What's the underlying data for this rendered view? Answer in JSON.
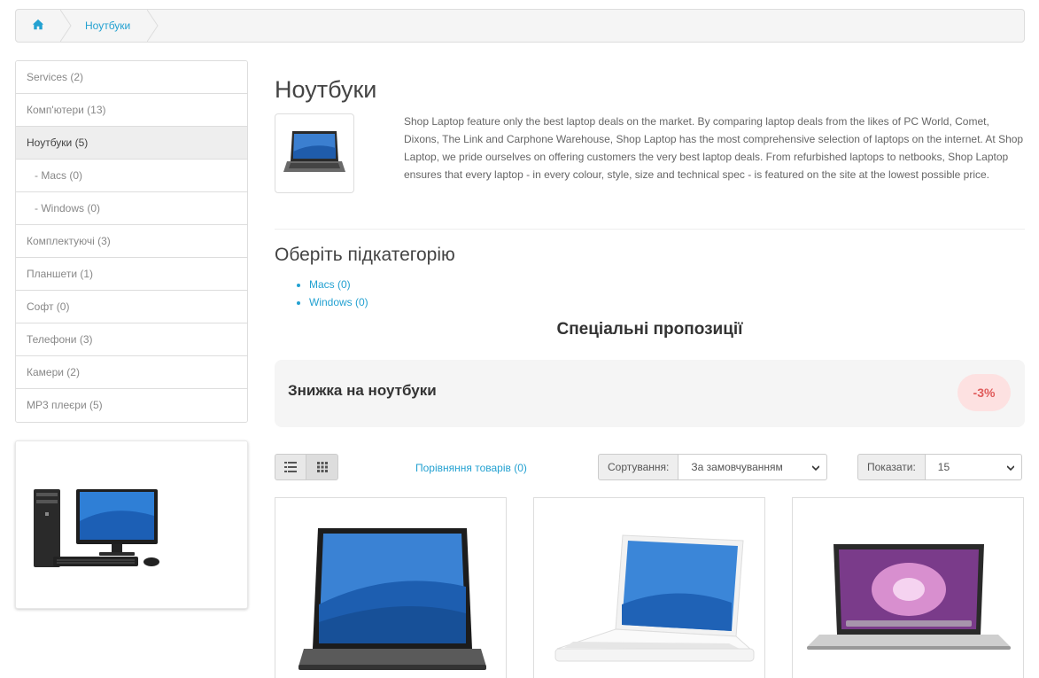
{
  "breadcrumb": {
    "home_icon": "home-icon",
    "current": "Ноутбуки"
  },
  "sidebar": {
    "items": [
      {
        "label": "Services (2)"
      },
      {
        "label": "Комп'ютери (13)"
      },
      {
        "label": "Ноутбуки (5)"
      },
      {
        "label": "- Macs (0)"
      },
      {
        "label": "- Windows (0)"
      },
      {
        "label": "Комплектуючі (3)"
      },
      {
        "label": "Планшети (1)"
      },
      {
        "label": "Софт (0)"
      },
      {
        "label": "Телефони (3)"
      },
      {
        "label": "Камери (2)"
      },
      {
        "label": "MP3 плеєри (5)"
      }
    ]
  },
  "category": {
    "title": "Ноутбуки",
    "description": "Shop Laptop feature only the best laptop deals on the market. By comparing laptop deals from the likes of PC World, Comet, Dixons, The Link and Carphone Warehouse, Shop Laptop has the most comprehensive selection of laptops on the internet. At Shop Laptop, we pride ourselves on offering customers the very best laptop deals. From refurbished laptops to netbooks, Shop Laptop ensures that every laptop - in every colour, style, size and technical spec - is featured on the site at the lowest possible price."
  },
  "subcategories": {
    "title": "Оберіть підкатегорію",
    "items": [
      "Macs (0)",
      "Windows (0)"
    ]
  },
  "specials": {
    "title": "Спеціальні пропозиції",
    "promo_title": "Знижка на ноутбуки",
    "promo_badge": "-3%"
  },
  "toolbar": {
    "compare_label": "Порівняння товарів (0)",
    "sort_label": "Сортування:",
    "sort_value": "За замовчуванням",
    "limit_label": "Показати:",
    "limit_value": "15"
  },
  "colors": {
    "link": "#23a1d1",
    "badge_bg": "#fde1e1",
    "badge_text": "#e05b5b"
  }
}
